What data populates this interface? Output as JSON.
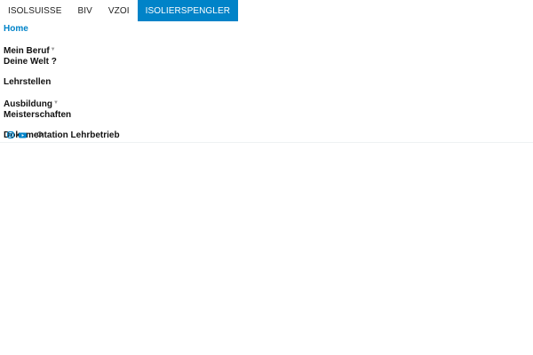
{
  "topbar": {
    "tabs": [
      {
        "label": "ISOLSUISSE"
      },
      {
        "label": "BIV"
      },
      {
        "label": "VZOI"
      },
      {
        "label": "ISOLIERSPENGLER",
        "active": true
      }
    ]
  },
  "menu": {
    "home": "Home",
    "mein_beruf": "Mein Beruf",
    "deine_welt": "Deine Welt ?",
    "lehrstellen": "Lehrstellen",
    "ausbildung": "Ausbildung",
    "meisterschaften": "Meisterschaften",
    "dokumentation": "Dokumentation Lehrbetrieb"
  },
  "social": {
    "icons": [
      "instagram-icon",
      "youtube-icon",
      "search-icon"
    ]
  },
  "colors": {
    "accent": "#0083c8",
    "text": "#111111"
  }
}
